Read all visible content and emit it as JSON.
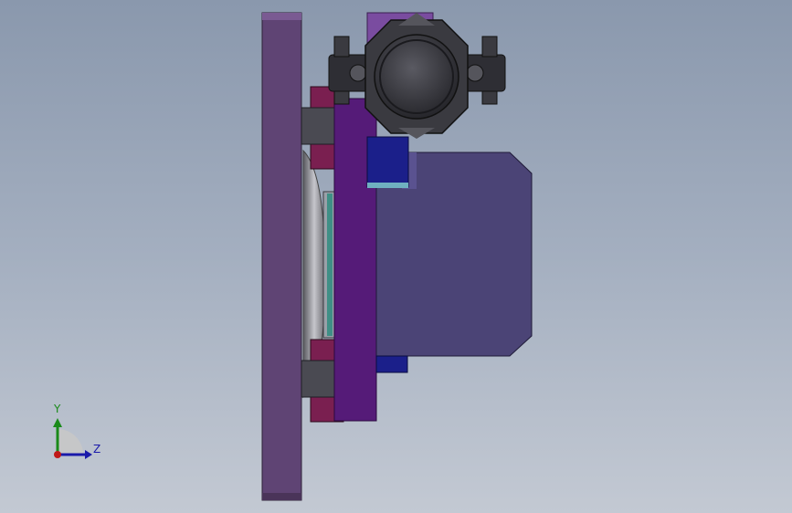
{
  "viewport": {
    "background_top": "#8a98ad",
    "background_bottom": "#c3c9d3"
  },
  "colors": {
    "plate_purple": "#5f4474",
    "plate_edge": "#3b2a49",
    "violet_panel": "#551b78",
    "motor_body": "#4b4476",
    "rail_block": "#7a1f50",
    "dark_part": "#2a2a2f",
    "blue_block": "#1b1f8a",
    "wheel_gray": "#8e8e95",
    "teal_edge": "#3f8f86"
  },
  "triad": {
    "y_label": "Y",
    "z_label": "Z",
    "y_color": "#1a8a1a",
    "z_color": "#1a1aaa",
    "origin_color": "#c01818"
  }
}
